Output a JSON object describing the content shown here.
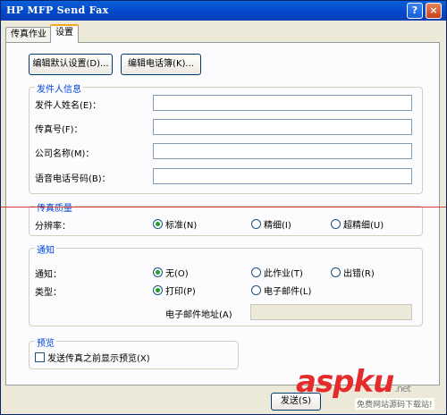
{
  "window": {
    "title": "HP MFP Send Fax",
    "help_label": "?",
    "close_label": "×"
  },
  "tabs": [
    {
      "label": "传真作业",
      "active": false
    },
    {
      "label": "设置",
      "active": true
    }
  ],
  "toolbar": {
    "edit_defaults_label": "编辑默认设置(D)...",
    "edit_phonebook_label": "编辑电话簿(K)..."
  },
  "sender_info": {
    "legend": "发件人信息",
    "fields": [
      {
        "label": "发件人姓名(E)：",
        "value": ""
      },
      {
        "label": "传真号(F)：",
        "value": ""
      },
      {
        "label": "公司名称(M)：",
        "value": ""
      },
      {
        "label": "语音电话号码(B)：",
        "value": ""
      }
    ]
  },
  "fax_quality": {
    "legend": "传真质量",
    "resolution_label": "分辨率：",
    "options": [
      {
        "label": "标准(N)",
        "selected": true
      },
      {
        "label": "精细(I)",
        "selected": false
      },
      {
        "label": "超精细(U)",
        "selected": false
      }
    ]
  },
  "notification": {
    "legend": "通知",
    "notify_label": "通知：",
    "notify_options": [
      {
        "label": "无(O)",
        "selected": true
      },
      {
        "label": "此作业(T)",
        "selected": false
      },
      {
        "label": "出错(R)",
        "selected": false
      }
    ],
    "type_label": "类型：",
    "type_options": [
      {
        "label": "打印(P)",
        "selected": true
      },
      {
        "label": "电子邮件(L)",
        "selected": false
      }
    ],
    "email_label": "电子邮件地址(A)",
    "email_value": ""
  },
  "preview": {
    "legend": "预览",
    "checkbox_label": "发送传真之前显示预览(X)",
    "checked": false
  },
  "footer": {
    "send_label": "发送(S)"
  },
  "watermark": {
    "logo": "aspku",
    "suffix": ".net",
    "tagline": "免费网站源码下载站!"
  },
  "colors": {
    "titlebar": "#0346c8",
    "dialog_bg": "#ece9d8",
    "legend_blue": "#0046d5",
    "radio_on": "#21a121",
    "watermark_red": "#e52b2b"
  }
}
